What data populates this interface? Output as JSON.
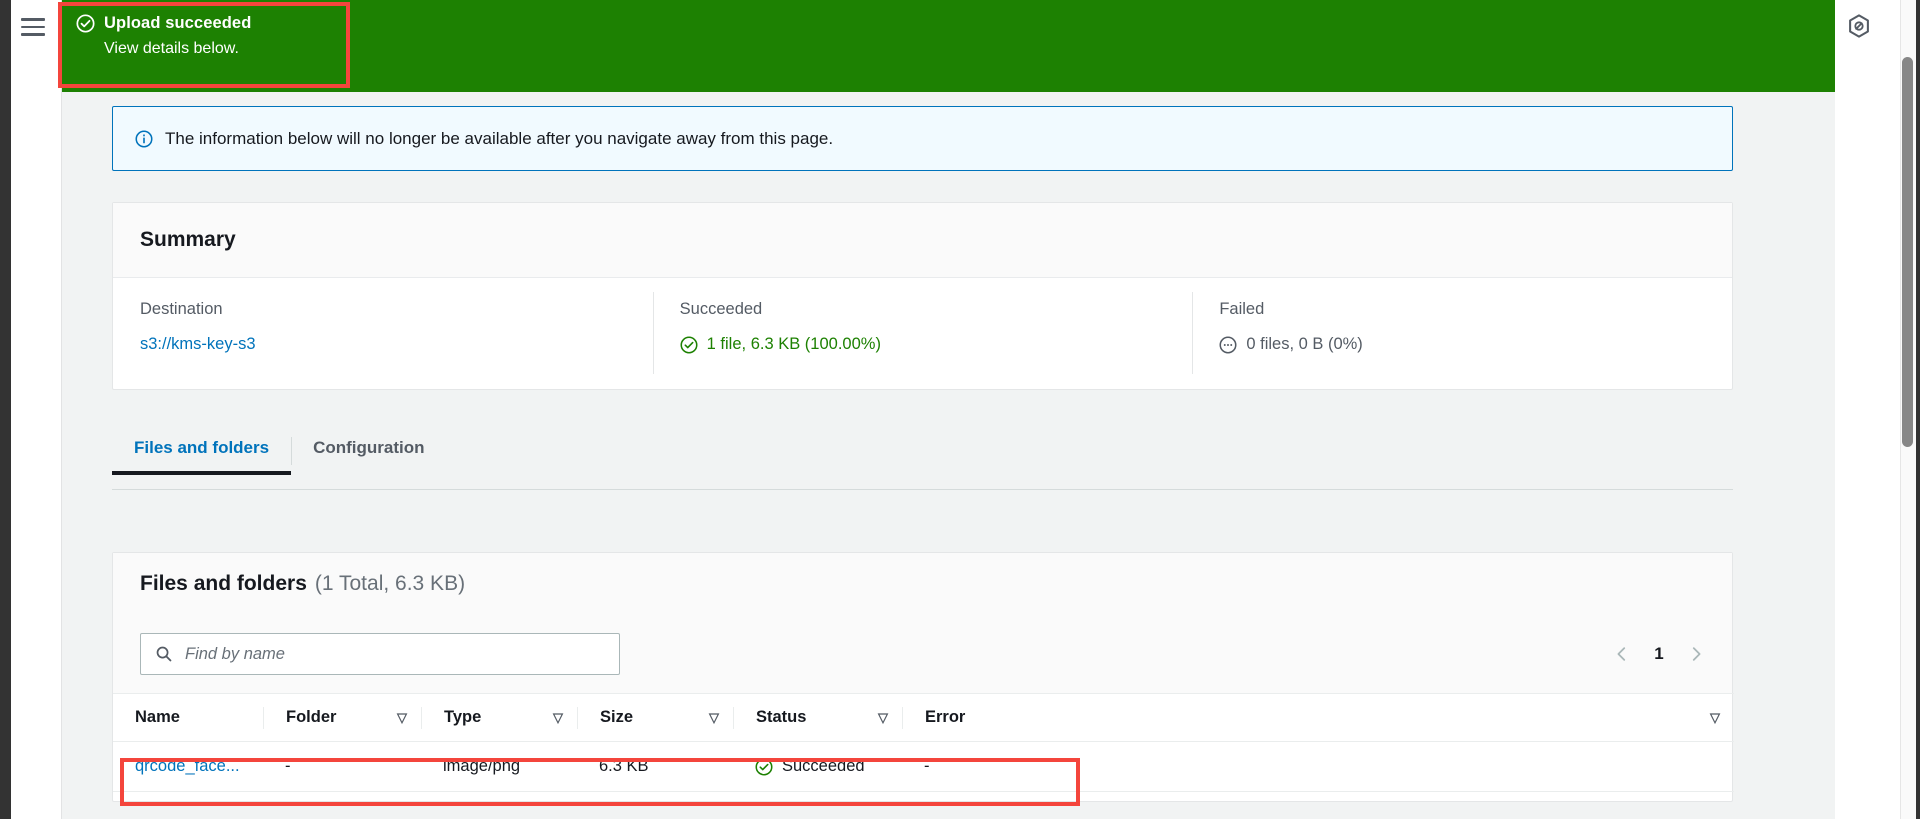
{
  "flash": {
    "icon": "check-circle-icon",
    "title": "Upload succeeded",
    "subtitle": "View details below.",
    "color": "#1d8102"
  },
  "nav": {
    "hamburger_icon": "hamburger-menu-icon",
    "right_icon": "aws-cloudshell-icon"
  },
  "info_alert": {
    "icon": "info-circle-icon",
    "text": "The information below will no longer be available after you navigate away from this page.",
    "border_color": "#0073bb",
    "background": "#f1faff"
  },
  "summary": {
    "title": "Summary",
    "columns": [
      {
        "label": "Destination",
        "value": "s3://kms-key-s3",
        "kind": "link"
      },
      {
        "label": "Succeeded",
        "value": "1 file, 6.3 KB (100.00%)",
        "kind": "success",
        "icon": "check-circle-icon",
        "color": "#1d8102"
      },
      {
        "label": "Failed",
        "value": "0 files, 0 B (0%)",
        "kind": "neutral",
        "icon": "ellipsis-circle-icon",
        "color": "#545b64"
      }
    ]
  },
  "tabs": [
    {
      "label": "Files and folders",
      "active": true
    },
    {
      "label": "Configuration",
      "active": false
    }
  ],
  "files_panel": {
    "title": "Files and folders",
    "count": "(1 Total, 6.3 KB)",
    "search": {
      "icon": "search-icon",
      "placeholder": "Find by name",
      "value": ""
    },
    "pagination": {
      "prev_icon": "chevron-left-icon",
      "next_icon": "chevron-right-icon",
      "current_page": "1"
    },
    "columns": [
      {
        "label": "Name",
        "sortable": false
      },
      {
        "label": "Folder",
        "sortable": true
      },
      {
        "label": "Type",
        "sortable": true
      },
      {
        "label": "Size",
        "sortable": true
      },
      {
        "label": "Status",
        "sortable": true
      },
      {
        "label": "Error",
        "sortable": true
      }
    ],
    "rows": [
      {
        "name": "qrcode_face...",
        "folder": "-",
        "type": "image/png",
        "size": "6.3 KB",
        "status": "Succeeded",
        "status_icon": "check-circle-icon",
        "error": "-"
      }
    ]
  },
  "annotations": {
    "flash_highlight_color": "#f4453c",
    "row_highlight_color": "#f4453c"
  }
}
